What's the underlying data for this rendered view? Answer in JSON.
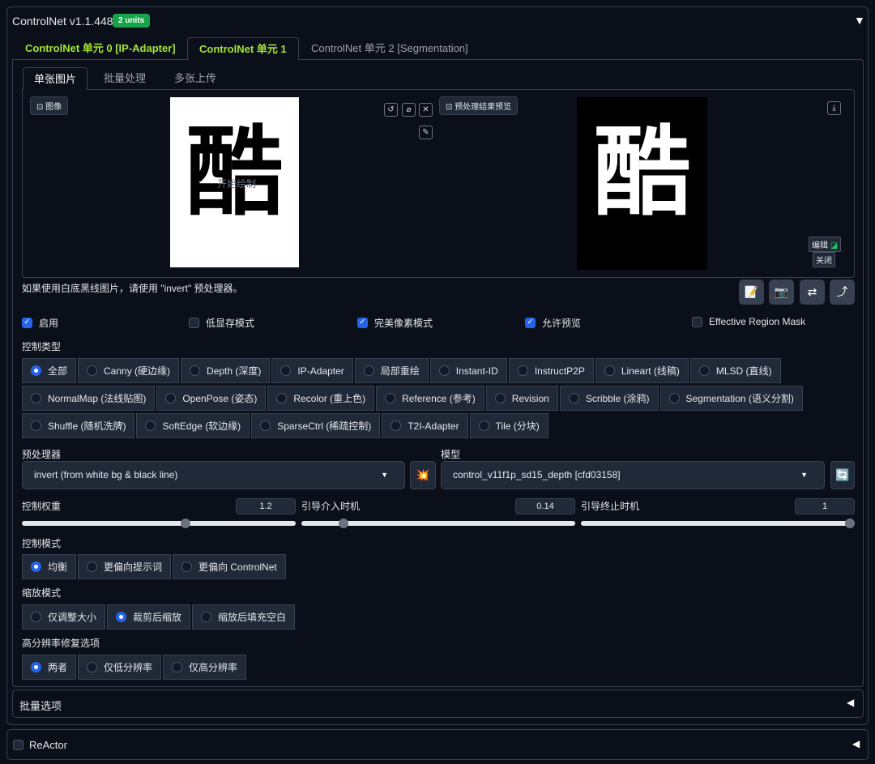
{
  "header": {
    "title": "ControlNet v1.1.448",
    "badge": "2 units",
    "collapse_glyph": "▼"
  },
  "unit_tabs": [
    {
      "label": "ControlNet 单元 0 [IP-Adapter]"
    },
    {
      "label": "ControlNet 单元 1"
    },
    {
      "label": "ControlNet 单元 2 [Segmentation]"
    }
  ],
  "sub_tabs": [
    {
      "label": "单张图片"
    },
    {
      "label": "批量处理"
    },
    {
      "label": "多张上传"
    }
  ],
  "image_panel": {
    "input_label": "图像",
    "preview_label": "预处理结果预览",
    "character": "酷",
    "canvas_overlay": "开始绘制",
    "edit_label": "编辑",
    "close_label": "关闭"
  },
  "hint": "如果使用白底黑线图片，请使用 \"invert\" 预处理器。",
  "options": {
    "enable": "启用",
    "low_vram": "低显存模式",
    "pixel_perfect": "完美像素模式",
    "allow_preview": "允许预览",
    "effective_region_mask": "Effective Region Mask"
  },
  "control_type": {
    "label": "控制类型",
    "row1": [
      "全部",
      "Canny (硬边缘)",
      "Depth (深度)",
      "IP-Adapter",
      "局部重绘",
      "Instant-ID",
      "InstructP2P",
      "Lineart (线稿)",
      "MLSD (直线)"
    ],
    "row2": [
      "NormalMap (法线贴图)",
      "OpenPose (姿态)",
      "Recolor (重上色)",
      "Reference (参考)",
      "Revision",
      "Scribble (涂鸦)",
      "Segmentation (语义分割)"
    ],
    "row3": [
      "Shuffle (随机洗牌)",
      "SoftEdge (软边缘)",
      "SparseCtrl (稀疏控制)",
      "T2I-Adapter",
      "Tile (分块)"
    ]
  },
  "preprocessor": {
    "label": "预处理器",
    "value": "invert (from white bg & black line)"
  },
  "model": {
    "label": "模型",
    "value": "control_v11f1p_sd15_depth [cfd03158]"
  },
  "sliders": {
    "weight": {
      "label": "控制权重",
      "value": "1.2",
      "fraction": 0.6
    },
    "start": {
      "label": "引导介入时机",
      "value": "0.14",
      "fraction": 0.14
    },
    "end": {
      "label": "引导终止时机",
      "value": "1",
      "fraction": 1.0
    }
  },
  "control_mode": {
    "label": "控制模式",
    "options": [
      "均衡",
      "更偏向提示词",
      "更偏向 ControlNet"
    ]
  },
  "resize_mode": {
    "label": "缩放模式",
    "options": [
      "仅调整大小",
      "裁剪后缩放",
      "缩放后填充空白"
    ]
  },
  "hires_fix": {
    "label": "高分辨率修复选项",
    "options": [
      "两者",
      "仅低分辨率",
      "仅高分辨率"
    ]
  },
  "batch_options": {
    "label": "批量选项",
    "glyph": "◀"
  },
  "reactor": {
    "label": "ReActor",
    "glyph": "◀"
  }
}
